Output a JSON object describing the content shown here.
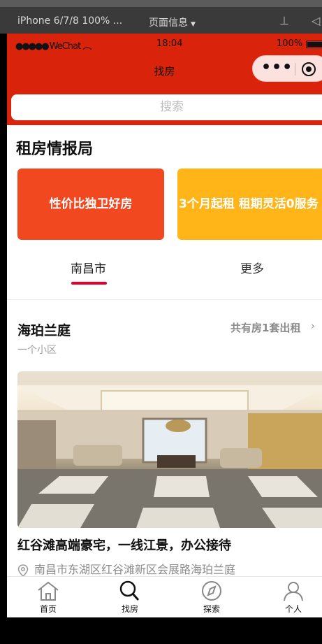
{
  "simulator": {
    "device": "iPhone 6/7/8 100% ...",
    "page_info": "页面信息"
  },
  "statusbar": {
    "carrier": "WeChat",
    "time": "18:04",
    "battery": "100%"
  },
  "nav": {
    "title": "找房"
  },
  "search": {
    "placeholder": "搜索"
  },
  "section": {
    "title": "租房情报局"
  },
  "promo_cards": [
    {
      "label": "性价比独卫好房",
      "color": "#f24820"
    },
    {
      "label": "3个月起租 租期灵活0服务",
      "color": "#ffb418"
    }
  ],
  "city_tabs": [
    {
      "label": "南昌市",
      "active": true
    },
    {
      "label": "更多",
      "active": false
    }
  ],
  "estate": {
    "name": "海珀兰庭",
    "count_text": "共有房1套出租",
    "subtitle": "一个小区"
  },
  "listing": {
    "title": "红谷滩高端豪宅，一线江景，办公接待",
    "address": "南昌市东湖区红谷滩新区会展路海珀兰庭"
  },
  "tabbar": [
    {
      "label": "首页",
      "icon": "home-icon"
    },
    {
      "label": "找房",
      "icon": "search-icon"
    },
    {
      "label": "探索",
      "icon": "compass-icon"
    },
    {
      "label": "个人",
      "icon": "person-icon"
    }
  ],
  "colors": {
    "brand_red": "#d9230b",
    "tab_accent": "#e4002b"
  }
}
